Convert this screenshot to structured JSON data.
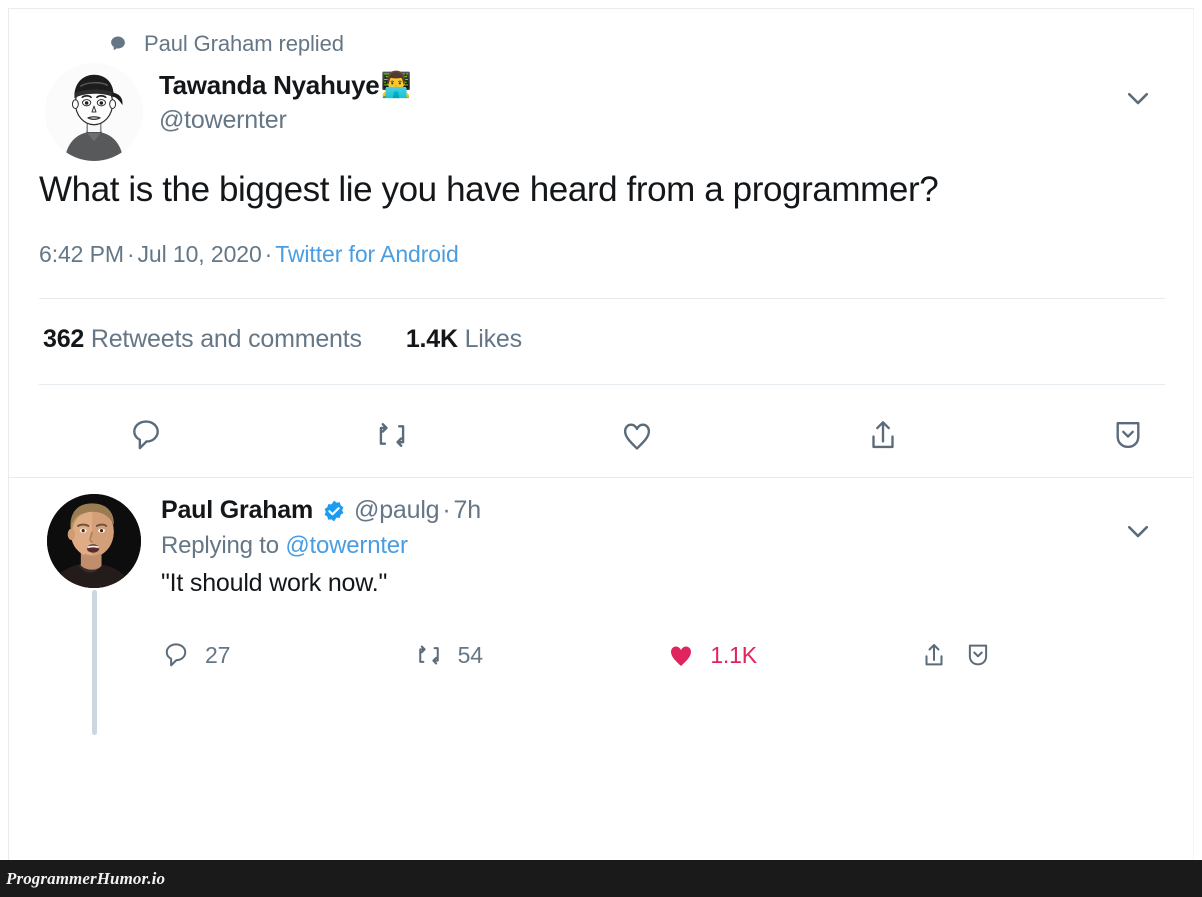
{
  "context": {
    "icon": "speech-bubble-icon",
    "label": "Paul Graham replied"
  },
  "tweet": {
    "author": {
      "display_name": "Tawanda Nyahuye",
      "name_emoji": "👨‍💻",
      "handle": "@towernter",
      "avatar": "cartoon-portrait-backwards-cap"
    },
    "text": "What is the biggest lie you have heard from a programmer?",
    "time": "6:42 PM",
    "date": "Jul 10, 2020",
    "source": "Twitter for Android",
    "separator": "·",
    "stats": [
      {
        "count": "362",
        "label": "Retweets and comments"
      },
      {
        "count": "1.4K",
        "label": "Likes"
      }
    ],
    "actions": [
      {
        "name": "reply-icon",
        "label": "Reply"
      },
      {
        "name": "retweet-icon",
        "label": "Retweet"
      },
      {
        "name": "like-icon",
        "label": "Like"
      },
      {
        "name": "share-icon",
        "label": "Share"
      },
      {
        "name": "bookmark-icon",
        "label": "Bookmark"
      }
    ],
    "caret": "chevron-down-icon"
  },
  "reply": {
    "author": {
      "display_name": "Paul Graham",
      "handle": "@paulg",
      "verified": true,
      "avatar": "photo-portrait-dark-background"
    },
    "timestamp": "7h",
    "separator": "·",
    "replying_to_prefix": "Replying to",
    "replying_to_mention": "@towernter",
    "text": "\"It should work now.\"",
    "actions": {
      "reply_count": "27",
      "retweet_count": "54",
      "like_count": "1.1K",
      "liked": true,
      "share_label": "Share",
      "bookmark_label": "Bookmark"
    },
    "caret": "chevron-down-icon"
  },
  "watermark": {
    "text": "ProgrammerHumor.io"
  },
  "colors": {
    "link": "#4a9de0",
    "muted": "#657786",
    "text": "#14171a",
    "like_red": "#e0245e",
    "verified_blue": "#1d9bf0",
    "divider": "#e6ecf0",
    "thread_line": "#ccd6dd"
  }
}
